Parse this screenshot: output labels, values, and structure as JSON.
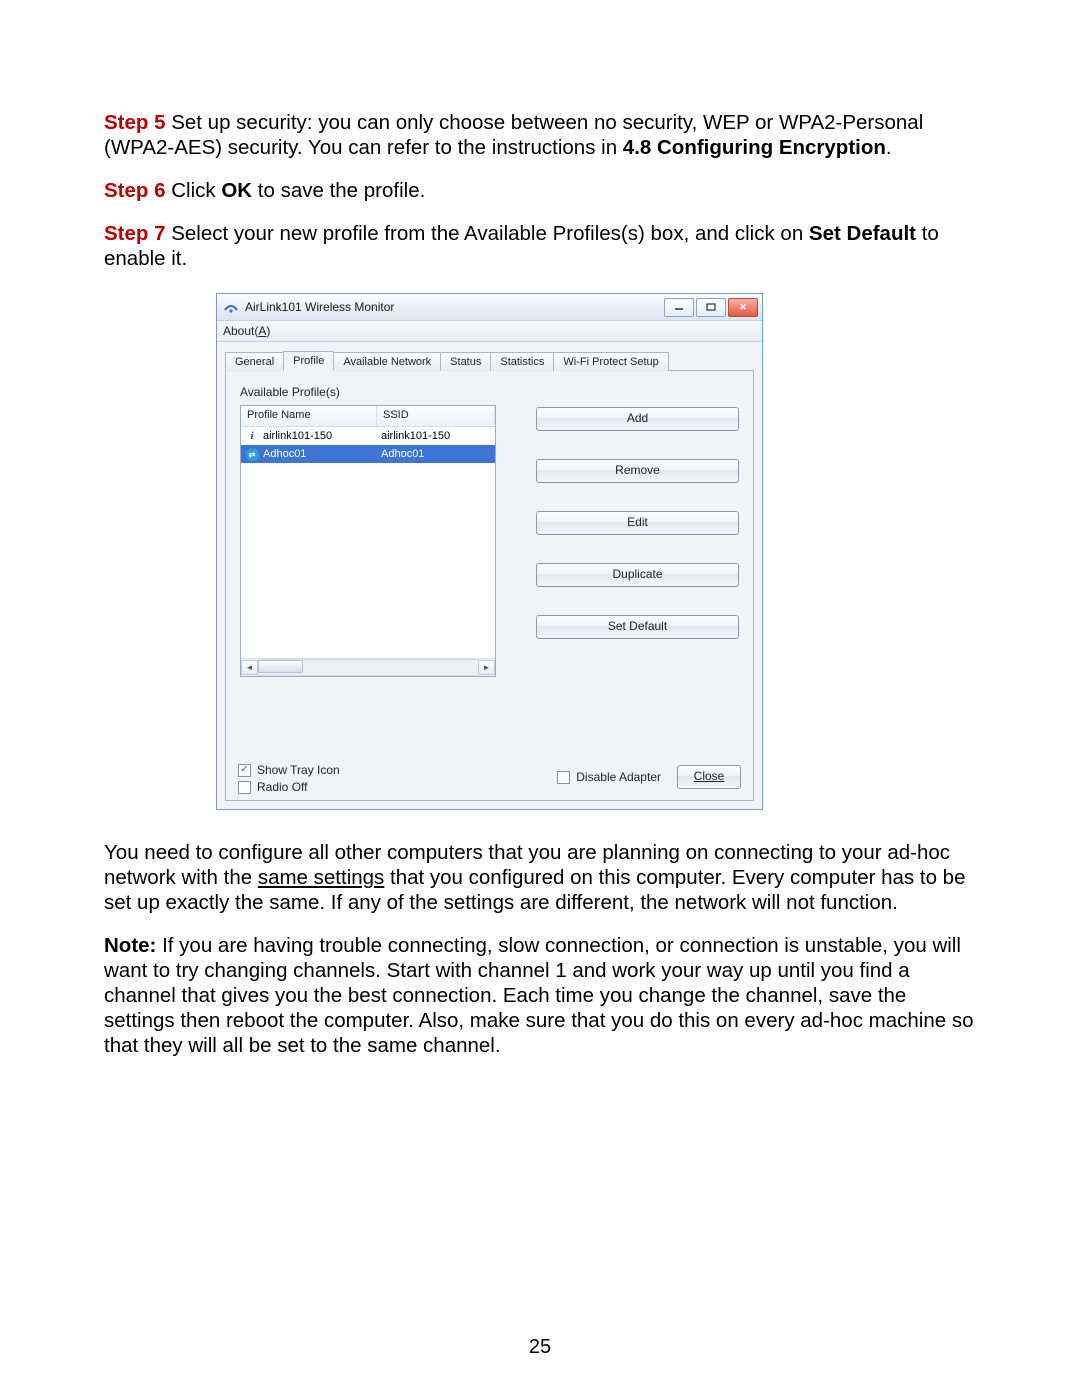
{
  "doc": {
    "page_number": "25",
    "steps": {
      "step5": {
        "label": "Step 5 ",
        "text1": "Set up security: you can only choose between no security, WEP or WPA2-Personal (WPA2-AES) security. You can refer to the instructions in ",
        "bold_ref": "4.8 Configuring Encryption",
        "text2": "."
      },
      "step6": {
        "label": "Step 6 ",
        "pre": "Click ",
        "bold_ok": "OK",
        "post": " to save the profile."
      },
      "step7": {
        "label": "Step 7 ",
        "pre": "Select your new profile from the Available Profiles(s) box, and click on ",
        "bold_sd": "Set Default",
        "post": " to enable it."
      }
    },
    "para_after_1a": "You need to configure all other computers that you are planning on connecting to your ad-hoc network with the ",
    "para_after_1_underline": "same settings",
    "para_after_1b": " that you configured on this computer. Every computer has to be set up exactly the same.  If any of the settings are different, the network will not function.",
    "note_label": "Note:",
    "note_text": " If you are having trouble connecting, slow connection, or connection is unstable, you will want to try changing channels. Start with channel 1 and work your way up until you find a channel that gives you the best connection. Each time you change the channel, save the settings then reboot the computer. Also, make sure that you do this on every ad-hoc machine so that they will all be set to the same channel."
  },
  "window": {
    "title": "AirLink101 Wireless Monitor",
    "menu_about_pre": "About(",
    "menu_about_u": "A",
    "menu_about_post": ")",
    "tabs": [
      "General",
      "Profile",
      "Available Network",
      "Status",
      "Statistics",
      "Wi-Fi Protect Setup"
    ],
    "available_label": "Available Profile(s)",
    "columns": {
      "name": "Profile Name",
      "ssid": "SSID"
    },
    "rows": [
      {
        "name": "airlink101-150",
        "ssid": "airlink101-150",
        "selected": false,
        "icon": "infra"
      },
      {
        "name": "Adhoc01",
        "ssid": "Adhoc01",
        "selected": true,
        "icon": "adhoc"
      }
    ],
    "buttons": {
      "add": "Add",
      "remove": "Remove",
      "edit": "Edit",
      "duplicate": "Duplicate",
      "set_default": "Set Default"
    },
    "checks": {
      "show_tray": "Show Tray Icon",
      "radio_off": "Radio Off",
      "disable_adapter": "Disable Adapter"
    },
    "close_btn": "Close"
  }
}
